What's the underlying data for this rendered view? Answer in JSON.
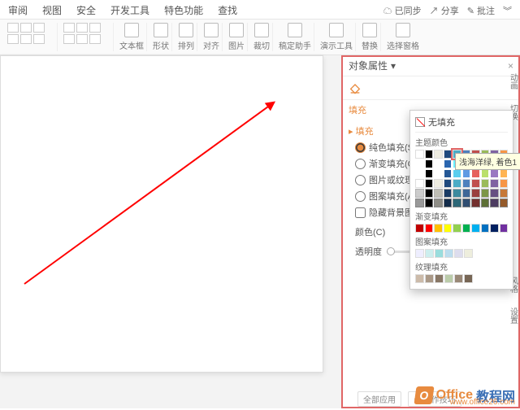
{
  "tabs": [
    "审阅",
    "视图",
    "安全",
    "开发工具",
    "特色功能",
    "查找"
  ],
  "status": {
    "sync": "已同步",
    "share": "分享",
    "comment": "批注"
  },
  "ribbon": {
    "textbox": "文本框",
    "shapes": "形状",
    "arrange": "排列",
    "align": "对齐",
    "image": "图片",
    "crop": "裁切",
    "assistant": "稿定助手",
    "present": "演示工具",
    "replace": "替换",
    "selpane": "选择窗格"
  },
  "panel": {
    "title": "对象属性",
    "fill_tab": "填充",
    "section": "填充",
    "radios": {
      "solid": "纯色填充(S)",
      "gradient": "渐变填充(G)",
      "picture": "图片或纹理填充",
      "pattern": "图案填充(A)",
      "hidebg": "隐藏背景图形"
    },
    "color_label": "颜色(C)",
    "opacity_label": "透明度"
  },
  "vtabs": {
    "anim": "动画",
    "switch": "切换",
    "style": "风格",
    "settings": "设置"
  },
  "popup": {
    "nofill": "无填充",
    "theme": "主题颜色",
    "gradient": "渐变填充",
    "pattern": "图案填充",
    "texture": "纹理填充",
    "tooltip": "浅海洋绿, 着色1",
    "theme_row1": [
      "#ffffff",
      "#000000",
      "#eeece1",
      "#1f497d",
      "#4bacc6",
      "#4f81bd",
      "#c0504d",
      "#9bbb59",
      "#8064a2",
      "#f79646"
    ],
    "theme_selected_index": 4,
    "std_colors": [
      "#c00000",
      "#ff0000",
      "#ffc000",
      "#ffff00",
      "#92d050",
      "#00b050",
      "#00b0f0",
      "#0070c0",
      "#002060",
      "#7030a0"
    ]
  },
  "watermark": {
    "brand1": "Office",
    "brand2": "教程网",
    "url": "www.office26.com"
  },
  "footer": {
    "apply": "全部应用",
    "tips": "操作技巧"
  }
}
